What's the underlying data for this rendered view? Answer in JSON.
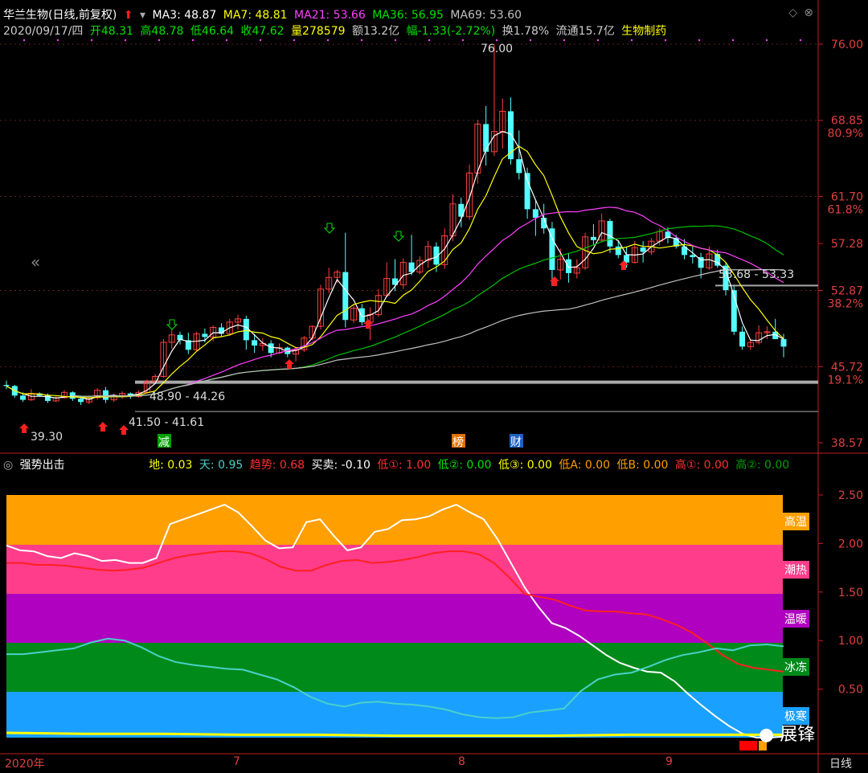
{
  "header": {
    "stock_name": "华兰生物(日线,前复权)",
    "ma3": "MA3: 48.87",
    "ma7": "MA7: 48.81",
    "ma21": "MA21: 53.66",
    "ma36": "MA36: 56.95",
    "ma69": "MA69: 53.60",
    "date": "2020/09/17/四",
    "open": "开48.31",
    "high": "高48.78",
    "low": "低46.64",
    "close": "收47.62",
    "volume": "量278579",
    "amount": "额13.2亿",
    "change": "幅-1.33(-2.72%)",
    "turnover": "换1.78%",
    "float": "流通15.7亿",
    "sector": "生物制药"
  },
  "indicator": {
    "name": "强势出击",
    "di": "地: 0.03",
    "tian": "天: 0.95",
    "trend": "趋势: 0.68",
    "buysell": "买卖: -0.10",
    "low1": "低①: 1.00",
    "low2": "低②: 0.00",
    "low3": "低③: 0.00",
    "lowA": "低A: 0.00",
    "lowB": "低B: 0.00",
    "high1": "高①: 0.00",
    "high2": "高②: 0.00"
  },
  "colors": {
    "up": "#ff4040",
    "down": "#54ffff",
    "ma3": "#ffffff",
    "ma7": "#ffff00",
    "ma21": "#ff40ff",
    "ma36": "#00c000",
    "ma69": "#c0c0c0"
  },
  "chart_data": {
    "type": "candlestick",
    "y_axis_labels": [
      "76.00",
      "68.85",
      "80.9%",
      "61.70",
      "61.8%",
      "57.28",
      "52.87",
      "38.2%",
      "45.72",
      "19.1%",
      "38.57"
    ],
    "x_axis_labels": [
      "2020年",
      "7",
      "8",
      "9",
      "日线"
    ],
    "annotations": [
      "76.00",
      "53.68 - 53.33",
      "48.90 - 44.26",
      "41.50 - 41.61",
      "39.30",
      "减",
      "榜",
      "财"
    ],
    "ylim": [
      38.57,
      76.0
    ],
    "candles": [
      [
        44.0,
        44.4,
        43.6,
        43.9
      ],
      [
        43.9,
        44.0,
        42.8,
        43.0
      ],
      [
        43.0,
        43.3,
        42.4,
        42.6
      ],
      [
        42.6,
        43.6,
        42.5,
        43.2
      ],
      [
        43.2,
        43.3,
        42.9,
        43.0
      ],
      [
        43.0,
        43.2,
        42.3,
        42.5
      ],
      [
        42.5,
        43.0,
        42.4,
        42.8
      ],
      [
        42.8,
        43.5,
        42.7,
        43.3
      ],
      [
        43.3,
        43.4,
        42.5,
        42.7
      ],
      [
        42.7,
        43.0,
        42.1,
        42.4
      ],
      [
        42.4,
        43.0,
        42.2,
        42.8
      ],
      [
        42.8,
        43.7,
        42.6,
        43.5
      ],
      [
        43.5,
        43.8,
        42.3,
        42.6
      ],
      [
        42.6,
        43.2,
        42.4,
        43.0
      ],
      [
        43.0,
        43.4,
        42.7,
        43.2
      ],
      [
        43.2,
        43.3,
        42.7,
        42.9
      ],
      [
        42.9,
        43.5,
        42.8,
        43.3
      ],
      [
        43.3,
        44.5,
        43.2,
        44.3
      ],
      [
        44.3,
        45.0,
        44.2,
        44.8
      ],
      [
        44.8,
        48.3,
        44.7,
        48.0
      ],
      [
        48.0,
        49.2,
        47.4,
        48.7
      ],
      [
        48.7,
        49.0,
        47.8,
        48.2
      ],
      [
        48.2,
        48.9,
        46.9,
        47.3
      ],
      [
        47.3,
        49.0,
        47.2,
        48.8
      ],
      [
        48.8,
        49.3,
        48.0,
        48.5
      ],
      [
        48.5,
        49.6,
        48.1,
        49.4
      ],
      [
        49.4,
        49.8,
        48.5,
        48.8
      ],
      [
        48.8,
        50.2,
        48.6,
        49.9
      ],
      [
        49.9,
        50.6,
        49.2,
        50.2
      ],
      [
        50.2,
        50.5,
        47.3,
        48.2
      ],
      [
        48.2,
        48.8,
        47.0,
        47.7
      ],
      [
        47.7,
        48.4,
        47.2,
        47.9
      ],
      [
        47.9,
        48.2,
        46.6,
        47.0
      ],
      [
        47.0,
        47.9,
        46.9,
        47.5
      ],
      [
        47.5,
        47.6,
        46.6,
        46.9
      ],
      [
        46.9,
        47.4,
        46.2,
        47.3
      ],
      [
        47.3,
        48.6,
        47.1,
        48.4
      ],
      [
        48.4,
        49.6,
        48.2,
        49.5
      ],
      [
        49.5,
        53.4,
        49.2,
        53.0
      ],
      [
        53.0,
        55.0,
        52.6,
        54.1
      ],
      [
        54.1,
        54.8,
        53.6,
        54.6
      ],
      [
        54.6,
        58.3,
        49.4,
        50.1
      ],
      [
        50.1,
        51.6,
        49.8,
        51.2
      ],
      [
        51.2,
        51.6,
        49.6,
        49.9
      ],
      [
        49.9,
        51.3,
        48.2,
        50.6
      ],
      [
        50.6,
        53.0,
        50.4,
        52.4
      ],
      [
        52.4,
        55.5,
        52.2,
        54.0
      ],
      [
        54.0,
        55.8,
        52.8,
        53.4
      ],
      [
        53.4,
        55.9,
        53.0,
        55.5
      ],
      [
        55.5,
        58.1,
        54.3,
        54.6
      ],
      [
        54.6,
        56.1,
        54.4,
        55.7
      ],
      [
        55.7,
        57.5,
        55.0,
        57.0
      ],
      [
        57.0,
        57.4,
        54.6,
        55.3
      ],
      [
        55.3,
        58.7,
        54.9,
        58.0
      ],
      [
        58.0,
        61.9,
        57.5,
        61.0
      ],
      [
        61.0,
        61.6,
        58.8,
        59.8
      ],
      [
        59.8,
        64.7,
        59.5,
        63.9
      ],
      [
        63.9,
        68.9,
        62.9,
        68.5
      ],
      [
        68.5,
        70.2,
        64.6,
        65.9
      ],
      [
        65.9,
        76.0,
        65.5,
        67.8
      ],
      [
        67.8,
        70.9,
        66.2,
        69.7
      ],
      [
        69.7,
        71.0,
        64.7,
        65.2
      ],
      [
        65.2,
        67.9,
        63.3,
        63.9
      ],
      [
        63.9,
        64.4,
        59.6,
        60.5
      ],
      [
        60.5,
        61.3,
        58.0,
        59.7
      ],
      [
        59.7,
        61.0,
        58.2,
        58.7
      ],
      [
        58.7,
        59.3,
        53.3,
        54.8
      ],
      [
        54.8,
        56.8,
        53.9,
        55.8
      ],
      [
        55.8,
        56.4,
        53.6,
        54.5
      ],
      [
        54.5,
        55.8,
        54.0,
        55.0
      ],
      [
        55.0,
        58.3,
        54.8,
        57.9
      ],
      [
        57.9,
        59.1,
        57.1,
        57.6
      ],
      [
        57.6,
        60.1,
        57.4,
        59.4
      ],
      [
        59.4,
        59.6,
        56.4,
        57.0
      ],
      [
        57.0,
        57.6,
        55.9,
        56.2
      ],
      [
        56.2,
        57.0,
        55.0,
        55.5
      ],
      [
        55.5,
        57.5,
        55.4,
        56.9
      ],
      [
        56.9,
        57.5,
        55.5,
        56.5
      ],
      [
        56.5,
        57.8,
        56.2,
        57.5
      ],
      [
        57.5,
        58.7,
        57.1,
        58.4
      ],
      [
        58.4,
        58.8,
        57.3,
        57.8
      ],
      [
        57.8,
        58.1,
        56.8,
        57.0
      ],
      [
        57.0,
        57.7,
        55.8,
        56.2
      ],
      [
        56.2,
        57.0,
        55.4,
        56.0
      ],
      [
        56.0,
        56.4,
        54.0,
        55.0
      ],
      [
        55.0,
        57.0,
        54.8,
        56.3
      ],
      [
        56.3,
        56.7,
        55.0,
        55.2
      ],
      [
        55.2,
        55.5,
        52.4,
        52.9
      ],
      [
        52.9,
        53.3,
        48.7,
        49.0
      ],
      [
        49.0,
        49.5,
        47.3,
        47.6
      ],
      [
        47.6,
        48.3,
        47.3,
        48.0
      ],
      [
        48.0,
        49.6,
        47.8,
        48.9
      ],
      [
        48.9,
        49.5,
        48.3,
        49.0
      ],
      [
        49.0,
        50.2,
        48.4,
        48.3
      ],
      [
        48.3,
        48.8,
        46.6,
        47.6
      ]
    ],
    "ma_values": {
      "MA3": 48.87,
      "MA7": 48.81,
      "MA21": 53.66,
      "MA36": 56.95,
      "MA69": 53.6
    },
    "sub_chart": {
      "ylim": [
        0,
        2.6
      ],
      "ticks": [
        "2.50",
        "2.00",
        "1.50",
        "1.00",
        "0.50"
      ],
      "zones": [
        {
          "label": "高温",
          "from": 2.0,
          "to": 2.5,
          "color": "#ff9f00"
        },
        {
          "label": "潮热",
          "from": 1.5,
          "to": 2.0,
          "color": "#ff3d8b"
        },
        {
          "label": "温暖",
          "from": 1.0,
          "to": 1.5,
          "color": "#b000c0"
        },
        {
          "label": "冰冻",
          "from": 0.5,
          "to": 1.0,
          "color": "#008a1a"
        },
        {
          "label": "极寒",
          "from": 0.0,
          "to": 0.5,
          "color": "#1aa0ff"
        }
      ],
      "series": [
        {
          "name": "天",
          "color": "#ffffff",
          "values": [
            1.98,
            1.93,
            1.92,
            1.87,
            1.85,
            1.9,
            1.87,
            1.82,
            1.83,
            1.8,
            1.8,
            1.85,
            2.2,
            2.25,
            2.3,
            2.35,
            2.4,
            2.32,
            2.18,
            2.03,
            1.95,
            1.96,
            2.22,
            2.25,
            2.08,
            1.93,
            1.96,
            2.12,
            2.15,
            2.24,
            2.25,
            2.28,
            2.35,
            2.4,
            2.32,
            2.25,
            2.05,
            1.8,
            1.55,
            1.35,
            1.18,
            1.13,
            1.05,
            0.95,
            0.85,
            0.77,
            0.72,
            0.68,
            0.67,
            0.58,
            0.45,
            0.33,
            0.22,
            0.12,
            0.04,
            0.0,
            0.0,
            0.01
          ]
        },
        {
          "name": "趋势",
          "color": "#ff2020",
          "values": [
            1.8,
            1.8,
            1.78,
            1.78,
            1.77,
            1.75,
            1.73,
            1.72,
            1.73,
            1.75,
            1.8,
            1.85,
            1.88,
            1.9,
            1.92,
            1.92,
            1.9,
            1.84,
            1.76,
            1.72,
            1.72,
            1.78,
            1.82,
            1.83,
            1.8,
            1.81,
            1.83,
            1.86,
            1.9,
            1.92,
            1.92,
            1.89,
            1.8,
            1.65,
            1.48,
            1.45,
            1.42,
            1.36,
            1.31,
            1.3,
            1.3,
            1.28,
            1.27,
            1.22,
            1.16,
            1.08,
            0.97,
            0.85,
            0.76,
            0.72,
            0.7,
            0.68
          ]
        },
        {
          "name": "地",
          "color": "#4ad0c8",
          "values": [
            0.86,
            0.86,
            0.88,
            0.9,
            0.92,
            0.98,
            1.02,
            1.0,
            0.93,
            0.84,
            0.78,
            0.75,
            0.73,
            0.71,
            0.7,
            0.65,
            0.6,
            0.52,
            0.42,
            0.35,
            0.32,
            0.36,
            0.37,
            0.35,
            0.34,
            0.32,
            0.29,
            0.24,
            0.21,
            0.2,
            0.21,
            0.26,
            0.28,
            0.3,
            0.48,
            0.6,
            0.65,
            0.67,
            0.73,
            0.8,
            0.85,
            0.88,
            0.92,
            0.9,
            0.95,
            0.96,
            0.94
          ]
        },
        {
          "name": "买卖",
          "color": "#ffff00",
          "values": [
            0.05,
            0.04,
            0.04,
            0.03,
            0.03,
            0.02,
            0.02,
            0.02,
            0.03,
            0.03,
            0.03
          ]
        }
      ]
    }
  }
}
